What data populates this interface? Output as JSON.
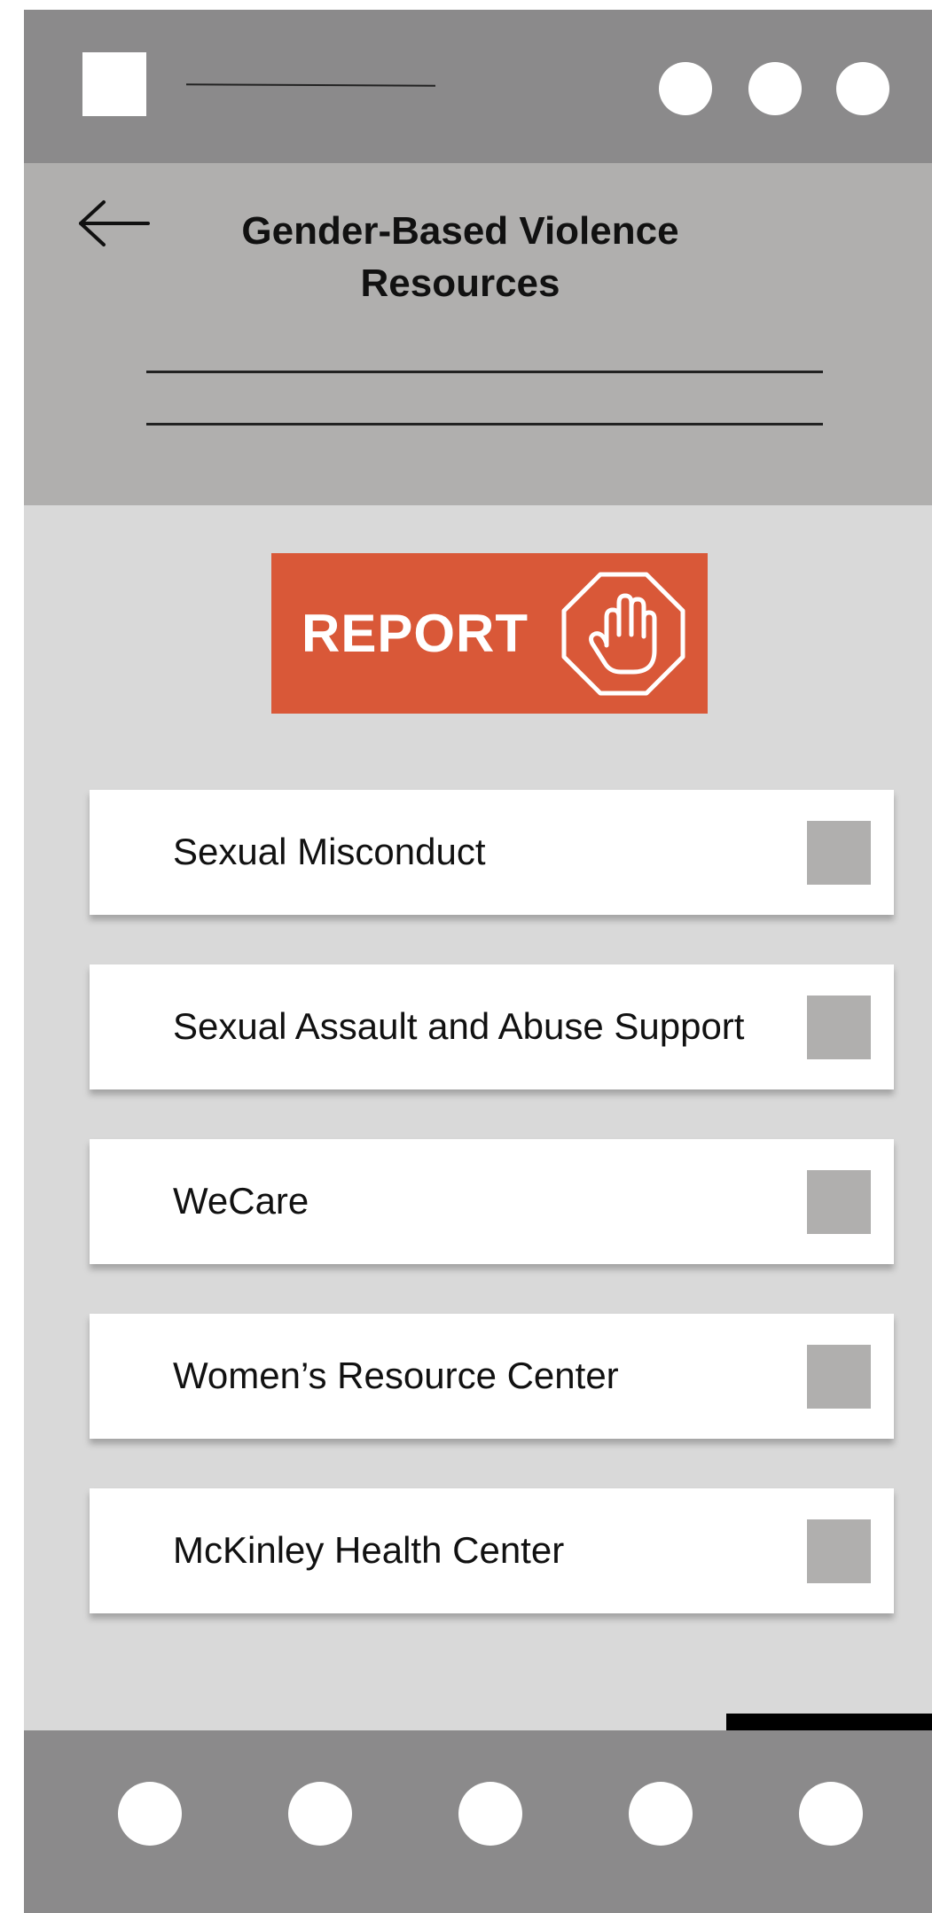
{
  "header": {
    "title": "Gender-Based Violence Resources",
    "back_icon": "arrow-left-icon"
  },
  "report": {
    "label": "REPORT",
    "icon": "stop-hand-icon",
    "color": "#d95838"
  },
  "resources": [
    {
      "label": "Sexual Misconduct"
    },
    {
      "label": "Sexual Assault and Abuse Support"
    },
    {
      "label": "WeCare"
    },
    {
      "label": "Women’s Resource Center"
    },
    {
      "label": "McKinley Health Center"
    }
  ]
}
